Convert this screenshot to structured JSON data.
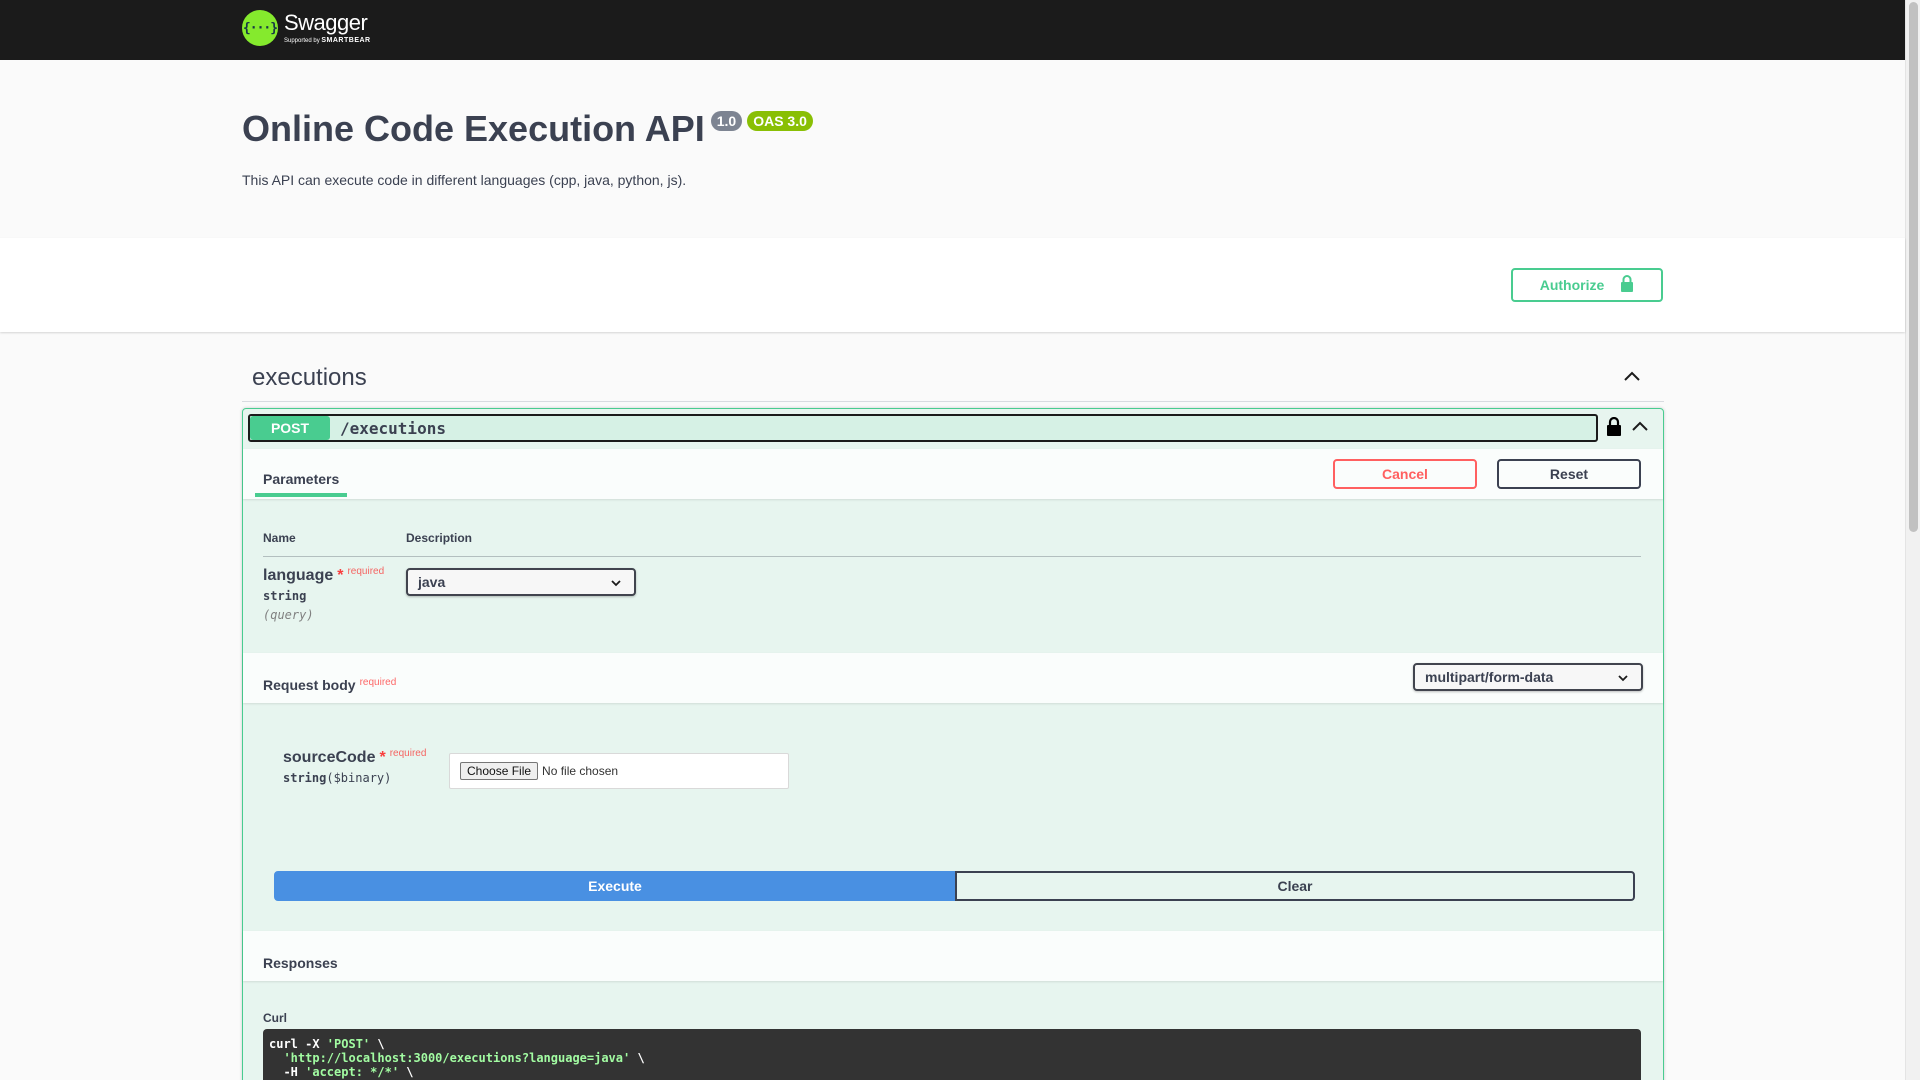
{
  "topbar": {
    "logo_mark": "{···}",
    "logo_name": "Swagger",
    "logo_sub_prefix": "Supported by",
    "logo_sub_brand": "SMARTBEAR"
  },
  "info": {
    "title": "Online Code Execution API",
    "version_badge": "1.0",
    "oas_badge": "OAS 3.0",
    "description": "This API can execute code in different languages (cpp, java, python, js)."
  },
  "scheme": {
    "authorize_label": "Authorize",
    "authorize_icon": "lock-icon"
  },
  "tag": {
    "name": "executions",
    "toggle_icon": "chevron-up-icon"
  },
  "operation": {
    "method": "POST",
    "path": "/executions",
    "lock_icon": "lock-icon",
    "collapse_icon": "chevron-up-icon",
    "params_tab": "Parameters",
    "cancel_label": "Cancel",
    "reset_label": "Reset",
    "col_name": "Name",
    "col_description": "Description",
    "param": {
      "name": "language",
      "required_star": "*",
      "required_label": "required",
      "type": "string",
      "in": "(query)",
      "selected": "java"
    },
    "request_body": {
      "title": "Request body",
      "required_label": "required",
      "content_type": "multipart/form-data",
      "field_name": "sourceCode",
      "field_star": "*",
      "field_required": "required",
      "field_type": "string",
      "field_format": "($binary)",
      "file_button": "Choose File",
      "file_status": "No file chosen"
    },
    "execute_label": "Execute",
    "clear_label": "Clear",
    "responses_title": "Responses",
    "curl_label": "Curl",
    "curl_lines": [
      {
        "pre": "curl -X ",
        "str": "'POST'",
        "post": " \\"
      },
      {
        "pre": "  ",
        "str": "'http://localhost:3000/executions?language=java'",
        "post": " \\"
      },
      {
        "pre": "  -H ",
        "str": "'accept: */*'",
        "post": " \\"
      }
    ]
  },
  "colors": {
    "topbar_bg": "#1b1b1b",
    "post_green": "#49cc90",
    "execute_blue": "#4990e2",
    "cancel_red": "#ff6060",
    "badge_gray": "#7d8492",
    "badge_oas": "#89bf04"
  }
}
